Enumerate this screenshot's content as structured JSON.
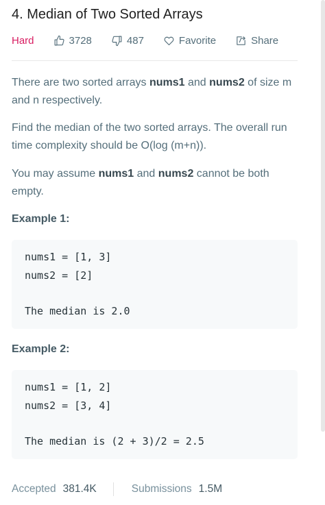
{
  "problem": {
    "title": "4. Median of Two Sorted Arrays",
    "difficulty": "Hard",
    "likes": "3728",
    "dislikes": "487",
    "favorite_label": "Favorite",
    "share_label": "Share"
  },
  "description": {
    "p1": {
      "before": "There are two sorted arrays ",
      "b1": "nums1",
      "mid": " and ",
      "b2": "nums2",
      "after": " of size m and n respectively."
    },
    "p2": "Find the median of the two sorted arrays. The overall run time complexity should be O(log (m+n)).",
    "p3": {
      "before": "You may assume ",
      "b1": "nums1",
      "mid": " and ",
      "b2": "nums2",
      "after": " cannot be both empty."
    }
  },
  "examples": [
    {
      "title": "Example 1:",
      "lines": [
        "nums1 = [1, 3]",
        "nums2 = [2]",
        "The median is 2.0"
      ]
    },
    {
      "title": "Example 2:",
      "lines": [
        "nums1 = [1, 2]",
        "nums2 = [3, 4]",
        "The median is (2 + 3)/2 = 2.5"
      ]
    }
  ],
  "stats": {
    "accepted_label": "Accepted",
    "accepted_value": "381.4K",
    "submissions_label": "Submissions",
    "submissions_value": "1.5M"
  },
  "icons": {
    "like": "thumbs-up-icon",
    "dislike": "thumbs-down-icon",
    "favorite": "heart-icon",
    "share": "share-icon"
  },
  "colors": {
    "hard": "#d81b60",
    "text": "#546e7a",
    "code_bg": "#f7f9fa"
  }
}
